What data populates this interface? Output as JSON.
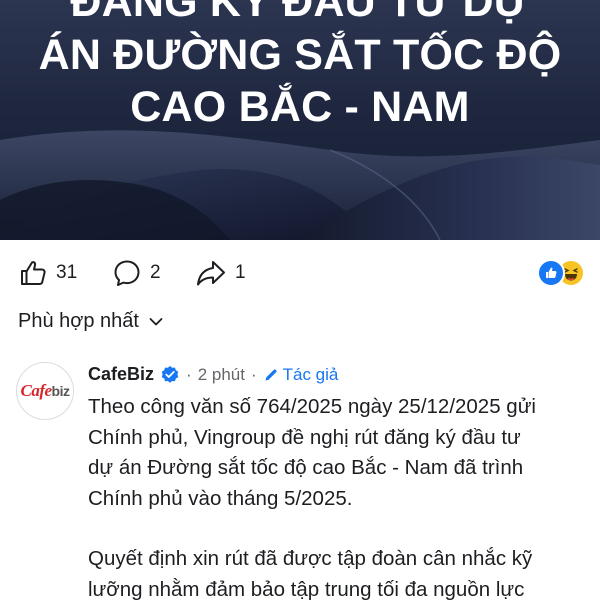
{
  "post": {
    "title_lines": [
      "ĐĂNG KÝ ĐẦU TƯ DỰ",
      "ÁN ĐƯỜNG SẮT TỐC ĐỘ",
      "CAO BẮC - NAM"
    ]
  },
  "reactions": {
    "like_count": "31",
    "comment_count": "2",
    "share_count": "1",
    "summary_icons": [
      "like-emoji",
      "haha-emoji"
    ]
  },
  "sort": {
    "label": "Phù hợp nhất"
  },
  "comment": {
    "author": "CafeBiz",
    "verified": true,
    "time": "2 phút",
    "author_badge": "Tác giả",
    "avatar_text_red": "Cafe",
    "avatar_text_gray": "biz",
    "lines": [
      "Theo công văn số 764/2025 ngày 25/12/2025 gửi",
      "Chính phủ, Vingroup đề nghị rút đăng ký đầu tư",
      "dự án Đường sắt tốc độ cao Bắc - Nam đã trình",
      "Chính phủ vào tháng 5/2025.",
      "",
      "Quyết định xin rút đã được tập đoàn cân nhắc kỹ",
      "lưỡng nhằm đảm bảo tập trung tối đa nguồn lực"
    ]
  },
  "colors": {
    "accent": "#1877f2",
    "verified": "#1877f2",
    "secondary_text": "#65676b"
  }
}
